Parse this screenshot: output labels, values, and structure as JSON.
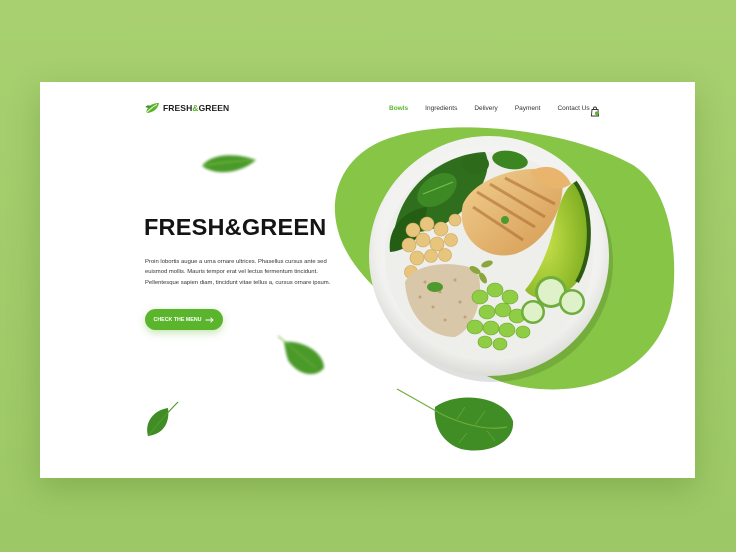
{
  "brand": {
    "prefix": "FRESH",
    "amp": "&",
    "suffix": "GREEN"
  },
  "nav": {
    "items": [
      "Bowls",
      "Ingredients",
      "Delivery",
      "Payment",
      "Contact Us"
    ],
    "active_index": 0
  },
  "hero": {
    "title": "FRESH&GREEN",
    "description": "Proin lobortis augue a urna ornare ultrices. Phasellus cursus ante sed euismod mollis. Mauris tempor erat vel lectus fermentum tincidunt. Pellentesque sapien diam, tincidunt vitae tellus a, cursus ornare ipsum.",
    "cta_label": "CHECK THE MENU"
  },
  "colors": {
    "accent": "#5bb52c",
    "blob": "#86c545",
    "background": "#a3cd6b",
    "text": "#141414"
  },
  "icons": {
    "logo": "leaf-logo-icon",
    "cart": "shopping-bag-icon",
    "cta_arrow": "arrow-right-icon"
  }
}
